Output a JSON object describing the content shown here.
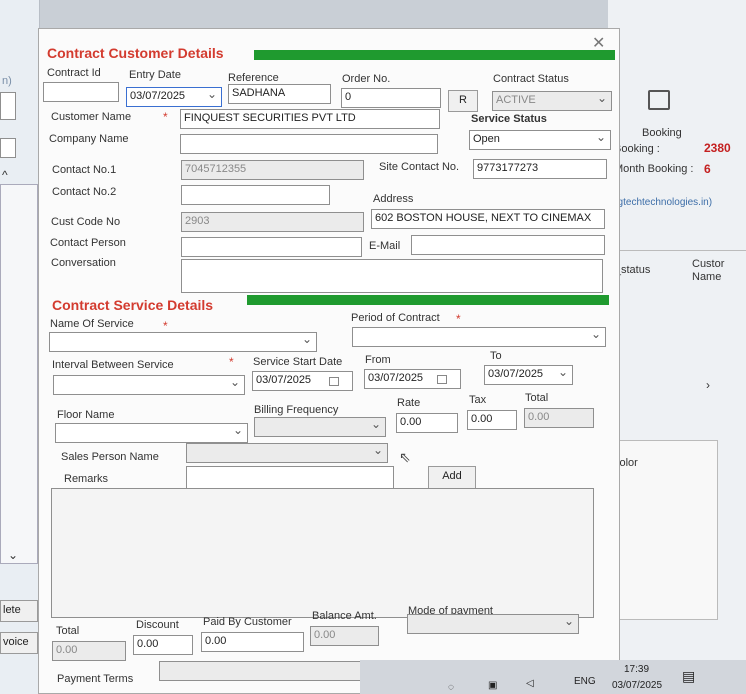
{
  "left_panel": {
    "top_text": "n)",
    "delete_label": "lete",
    "invoice_label": "voice"
  },
  "right_panel": {
    "booking_label": "Booking",
    "booking_count_label": "Booking :",
    "booking_count_value": "2380",
    "month_booking_label": "Month Booking :",
    "month_booking_value": "6",
    "email_text": "ngtechtechnologies.in)",
    "status_col": "ll_status",
    "customer_col_line1": "Custor",
    "customer_col_line2": "Name",
    "color_label": "color"
  },
  "customer": {
    "section_title": "Contract Customer Details",
    "contract_id_label": "Contract Id",
    "entry_date_label": "Entry Date",
    "entry_date_value": "03/07/2025",
    "reference_label": "Reference",
    "reference_value": "SADHANA",
    "order_no_label": "Order No.",
    "order_no_value": "0",
    "r_button": "R",
    "contract_status_label": "Contract Status",
    "contract_status_value": "ACTIVE",
    "customer_name_label": "Customer Name",
    "customer_name_value": "FINQUEST SECURITIES PVT LTD",
    "service_status_label": "Service Status",
    "service_status_value": "Open",
    "company_name_label": "Company Name",
    "contact1_label": "Contact No.1",
    "contact1_value": "7045712355",
    "site_contact_label": "Site Contact No.",
    "site_contact_value": "9773177273",
    "contact2_label": "Contact No.2",
    "address_label": "Address",
    "address_value": "602 BOSTON HOUSE, NEXT TO CINEMAX",
    "cust_code_label": "Cust Code No",
    "cust_code_value": "2903",
    "contact_person_label": "Contact Person",
    "email_label": "E-Mail",
    "conversation_label": "Conversation"
  },
  "service": {
    "section_title": "Contract Service Details",
    "name_of_service_label": "Name Of Service",
    "period_label": "Period of Contract",
    "interval_label": "Interval Between Service",
    "start_date_label": "Service Start Date",
    "start_date_value": "03/07/2025",
    "from_label": "From",
    "from_value": "03/07/2025",
    "to_label": "To",
    "to_value": "03/07/2025",
    "floor_name_label": "Floor Name",
    "billing_freq_label": "Billing Frequency",
    "rate_label": "Rate",
    "rate_value": "0.00",
    "tax_label": "Tax",
    "tax_value": "0.00",
    "total_label": "Total",
    "total_value": "0.00",
    "sales_person_label": "Sales Person Name",
    "remarks_label": "Remarks",
    "add_button": "Add"
  },
  "footer": {
    "total_label": "Total",
    "total_value": "0.00",
    "discount_label": "Discount",
    "discount_value": "0.00",
    "paid_label": "Paid By Customer",
    "paid_value": "0.00",
    "balance_label": "Balance Amt.",
    "balance_value": "0.00",
    "mode_label": "Mode of payment",
    "payment_terms_label": "Payment Terms"
  },
  "taskbar": {
    "lang": "ENG",
    "time": "17:39",
    "date": "03/07/2025"
  }
}
